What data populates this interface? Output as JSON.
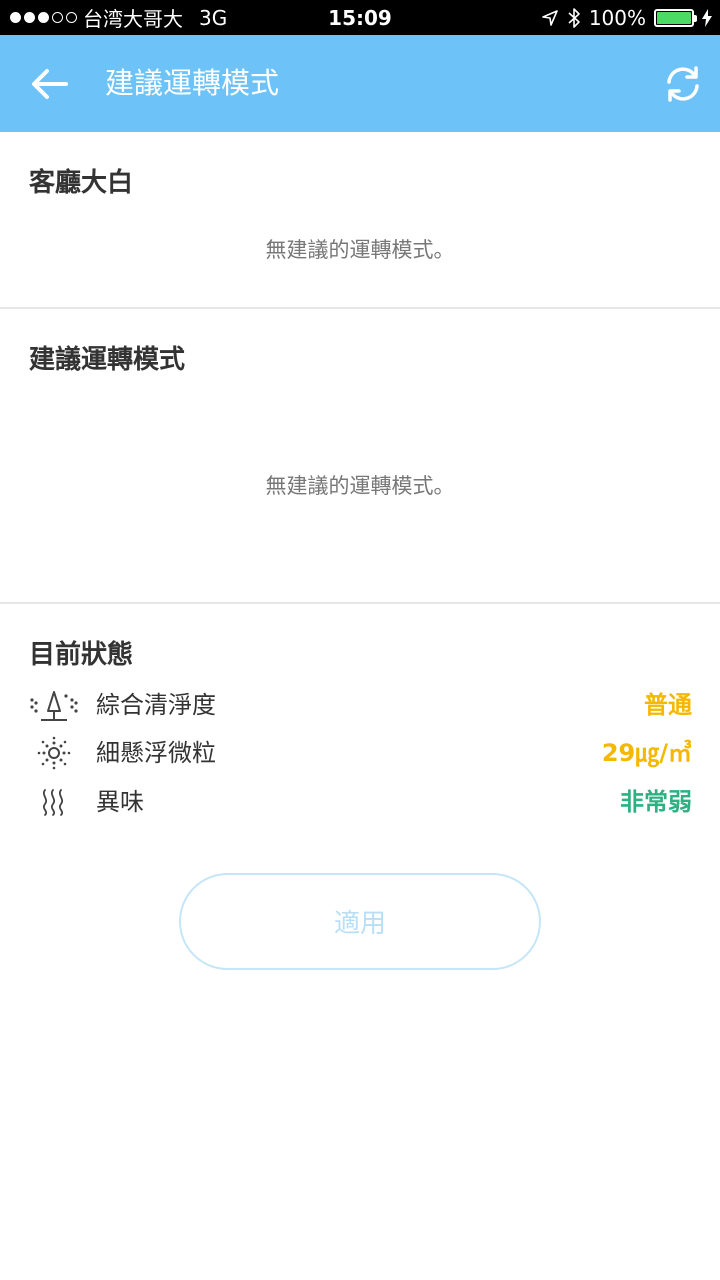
{
  "status_bar": {
    "carrier": "台湾大哥大",
    "network": "3G",
    "time": "15:09",
    "battery": "100%"
  },
  "header": {
    "title": "建議運轉模式",
    "back_icon": "arrow-left-icon",
    "refresh_icon": "refresh-icon"
  },
  "section1": {
    "title": "客廳大白",
    "empty_message": "無建議的運轉模式。"
  },
  "section2": {
    "title": "建議運轉模式",
    "empty_message": "無建議的運轉模式。"
  },
  "current_status": {
    "title": "目前狀態",
    "rows": [
      {
        "icon": "cleanliness-icon",
        "label": "綜合清淨度",
        "value": "普通",
        "color": "#f5b800"
      },
      {
        "icon": "particle-icon",
        "label": "細懸浮微粒",
        "value": "29㎍/㎥",
        "color": "#f5b800"
      },
      {
        "icon": "odor-icon",
        "label": "異味",
        "value": "非常弱",
        "color": "#2fb083"
      }
    ]
  },
  "apply_button": {
    "label": "適用"
  },
  "colors": {
    "header_bg": "#6dc3f7",
    "accent_yellow": "#f5b800",
    "accent_green": "#2fb083"
  }
}
